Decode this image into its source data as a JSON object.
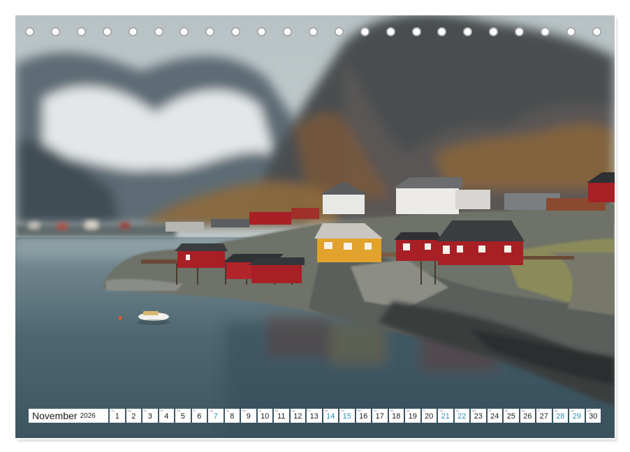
{
  "calendar": {
    "month": "November",
    "year": "2026",
    "days": [
      {
        "wd": "So",
        "n": "1",
        "weekend": false
      },
      {
        "wd": "Mo",
        "n": "2",
        "weekend": false
      },
      {
        "wd": "Di",
        "n": "3",
        "weekend": false
      },
      {
        "wd": "Mi",
        "n": "4",
        "weekend": false
      },
      {
        "wd": "Do",
        "n": "5",
        "weekend": false
      },
      {
        "wd": "Fr",
        "n": "6",
        "weekend": false
      },
      {
        "wd": "Sa",
        "n": "7",
        "weekend": true
      },
      {
        "wd": "So",
        "n": "8",
        "weekend": false
      },
      {
        "wd": "Mo",
        "n": "9",
        "weekend": false
      },
      {
        "wd": "Di",
        "n": "10",
        "weekend": false
      },
      {
        "wd": "Mi",
        "n": "11",
        "weekend": false
      },
      {
        "wd": "Do",
        "n": "12",
        "weekend": false
      },
      {
        "wd": "Fr",
        "n": "13",
        "weekend": false
      },
      {
        "wd": "Sa",
        "n": "14",
        "weekend": true
      },
      {
        "wd": "So",
        "n": "15",
        "weekend": true
      },
      {
        "wd": "Mo",
        "n": "16",
        "weekend": false
      },
      {
        "wd": "Di",
        "n": "17",
        "weekend": false
      },
      {
        "wd": "Mi",
        "n": "18",
        "weekend": false
      },
      {
        "wd": "Do",
        "n": "19",
        "weekend": false
      },
      {
        "wd": "Fr",
        "n": "20",
        "weekend": false
      },
      {
        "wd": "Sa",
        "n": "21",
        "weekend": true
      },
      {
        "wd": "So",
        "n": "22",
        "weekend": true
      },
      {
        "wd": "Mo",
        "n": "23",
        "weekend": false
      },
      {
        "wd": "Di",
        "n": "24",
        "weekend": false
      },
      {
        "wd": "Mi",
        "n": "25",
        "weekend": false
      },
      {
        "wd": "Do",
        "n": "26",
        "weekend": false
      },
      {
        "wd": "Fr",
        "n": "27",
        "weekend": false
      },
      {
        "wd": "Sa",
        "n": "28",
        "weekend": true
      },
      {
        "wd": "So",
        "n": "29",
        "weekend": true
      },
      {
        "wd": "Mo",
        "n": "30",
        "weekend": false
      }
    ]
  },
  "binding_rings": 23,
  "colors": {
    "weekend_number": "#2e8fb0",
    "house_red": "#a81f25",
    "house_yellow": "#e2a22c",
    "water": "#56707a"
  }
}
